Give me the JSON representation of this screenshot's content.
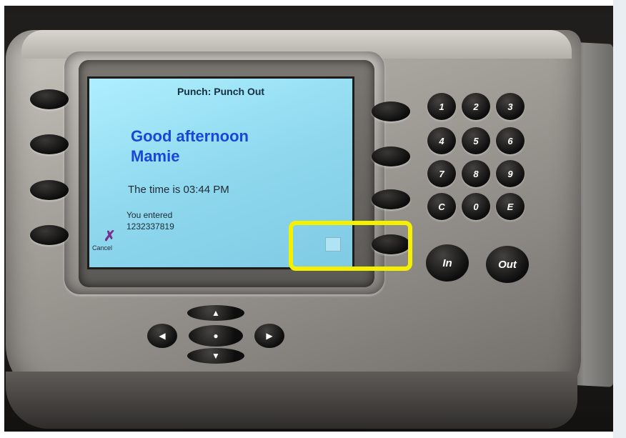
{
  "screen": {
    "title": "Punch: Punch Out",
    "greeting_line1": "Good afternoon",
    "greeting_line2": "Mamie",
    "time_text": "The time is 03:44 PM",
    "entered_label": "You entered",
    "entered_value": "1232337819",
    "cancel_label": "Cancel"
  },
  "keypad": {
    "keys": [
      "1",
      "2",
      "3",
      "4",
      "5",
      "6",
      "7",
      "8",
      "9",
      "C",
      "0",
      "E"
    ],
    "in_label": "In",
    "out_label": "Out"
  },
  "nav": {
    "up": "▲",
    "down": "▼",
    "left": "◀",
    "right": "▶",
    "center": "●"
  },
  "highlight": {
    "color": "#f4f000"
  },
  "colors": {
    "screen": "#9fe3f6",
    "greeting": "#1a46d8"
  }
}
